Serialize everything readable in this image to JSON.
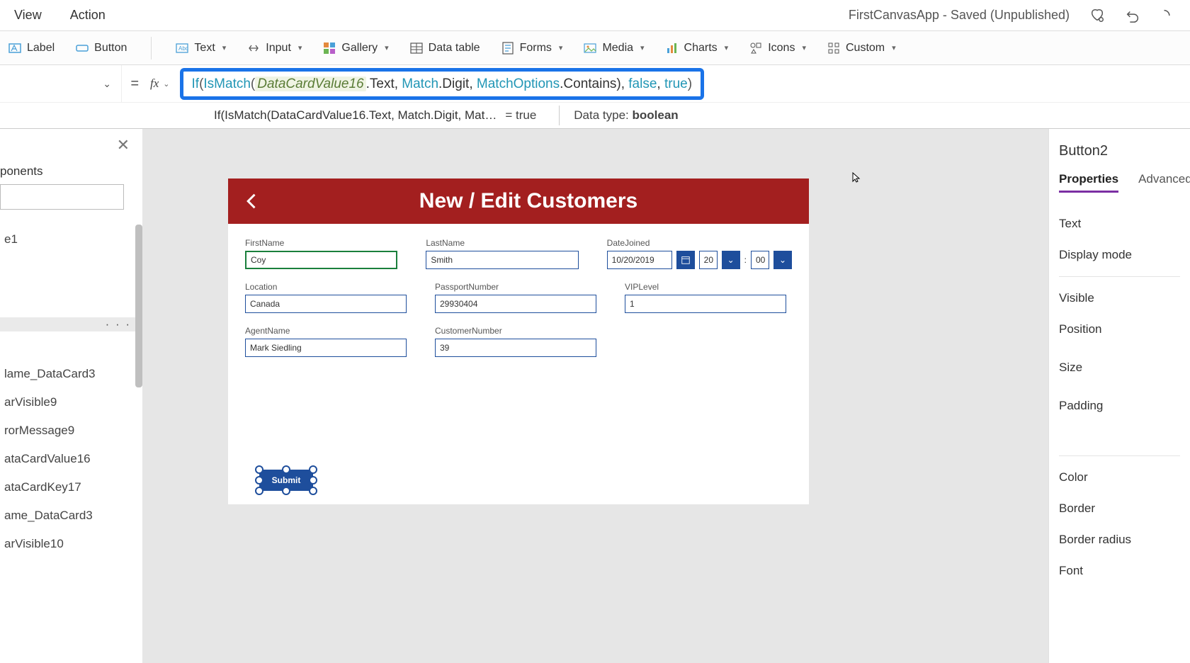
{
  "menubar": {
    "items": [
      "View",
      "Action"
    ],
    "app_status": "FirstCanvasApp - Saved (Unpublished)"
  },
  "ribbon": {
    "label": {
      "text": "Label"
    },
    "button": {
      "text": "Button"
    },
    "text": {
      "text": "Text"
    },
    "input": {
      "text": "Input"
    },
    "gallery": {
      "text": "Gallery"
    },
    "datatable": {
      "text": "Data table"
    },
    "forms": {
      "text": "Forms"
    },
    "media": {
      "text": "Media"
    },
    "charts": {
      "text": "Charts"
    },
    "icons": {
      "text": "Icons"
    },
    "custom": {
      "text": "Custom"
    }
  },
  "formula": {
    "tokens": {
      "if": "If",
      "ismatch": "IsMatch",
      "var": "DataCardValue16",
      "dottext": ".Text, ",
      "match": "Match",
      "dotdigit": ".Digit, ",
      "matchoptions": "MatchOptions",
      "dotcontains": ".Contains), ",
      "false": "false",
      "comma": ", ",
      "true": "true",
      "close": ")"
    },
    "status_left": "If(IsMatch(DataCardValue16.Text, Match.Digit, Mat…",
    "status_eq": "=  true",
    "status_dt_label": "Data type: ",
    "status_dt_value": "boolean"
  },
  "tree": {
    "section": "ponents",
    "item_e1": "e1",
    "selected_dots": "· · ·",
    "items_below": [
      "lame_DataCard3",
      "arVisible9",
      "rorMessage9",
      "ataCardValue16",
      "ataCardKey17",
      "ame_DataCard3",
      "arVisible10"
    ]
  },
  "canvas": {
    "header_title": "New / Edit Customers",
    "fields": {
      "firstname": {
        "label": "FirstName",
        "value": "Coy"
      },
      "lastname": {
        "label": "LastName",
        "value": "Smith"
      },
      "datejoined": {
        "label": "DateJoined",
        "value": "10/20/2019",
        "hour": "20",
        "minute": "00"
      },
      "location": {
        "label": "Location",
        "value": "Canada"
      },
      "passport": {
        "label": "PassportNumber",
        "value": "29930404"
      },
      "viplevel": {
        "label": "VIPLevel",
        "value": "1"
      },
      "agentname": {
        "label": "AgentName",
        "value": "Mark Siedling"
      },
      "custnum": {
        "label": "CustomerNumber",
        "value": "39"
      }
    },
    "submit": "Submit"
  },
  "right": {
    "element_name": "Button2",
    "tabs": {
      "properties": "Properties",
      "advanced": "Advanced"
    },
    "props": {
      "text": "Text",
      "display_mode": "Display mode",
      "visible": "Visible",
      "position": "Position",
      "size": "Size",
      "padding": "Padding",
      "color": "Color",
      "border": "Border",
      "border_radius": "Border radius",
      "font": "Font"
    }
  }
}
